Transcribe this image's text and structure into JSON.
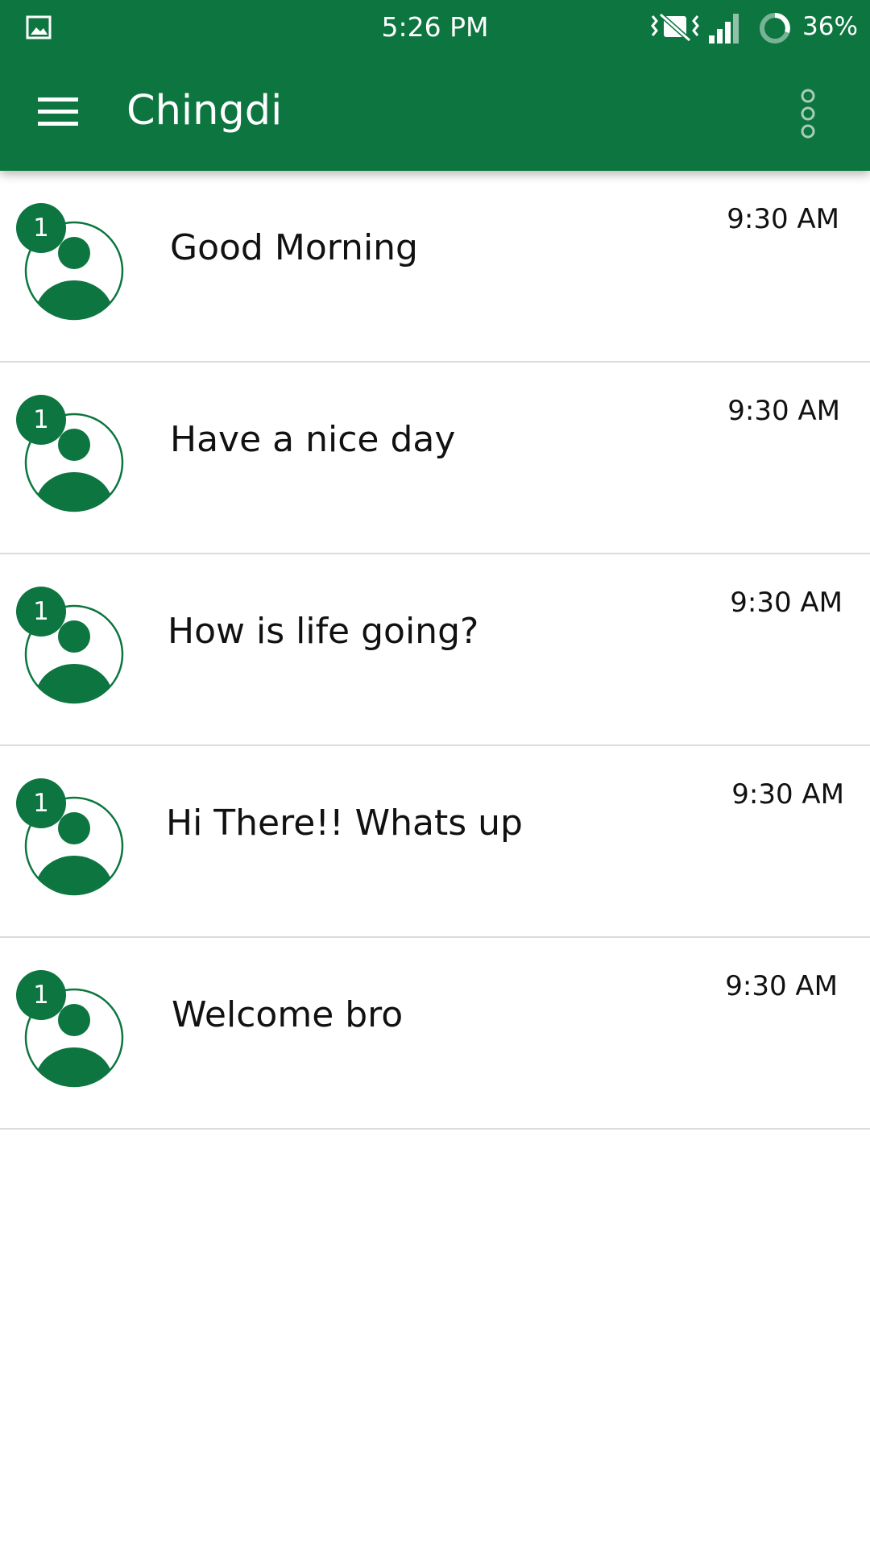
{
  "status_bar": {
    "time": "5:26 PM",
    "battery_percent": "36%",
    "icons": [
      "gallery-icon",
      "vibrate-icon",
      "signal-icon",
      "battery-icon"
    ]
  },
  "app_bar": {
    "title": "Chingdi",
    "menu_icon": "menu-icon",
    "overflow_icon": "overflow-menu-icon"
  },
  "colors": {
    "primary": "#0c7540",
    "divider": "#dcdcdc",
    "text": "#111111"
  },
  "chats": [
    {
      "badge": "1",
      "message": "Good Morning",
      "time": "9:30 AM"
    },
    {
      "badge": "1",
      "message": "Have a nice day",
      "time": "9:30 AM"
    },
    {
      "badge": "1",
      "message": "How is life going?",
      "time": "9:30 AM"
    },
    {
      "badge": "1",
      "message": "Hi There!! Whats up",
      "time": "9:30 AM"
    },
    {
      "badge": "1",
      "message": "Welcome bro",
      "time": "9:30 AM"
    }
  ]
}
